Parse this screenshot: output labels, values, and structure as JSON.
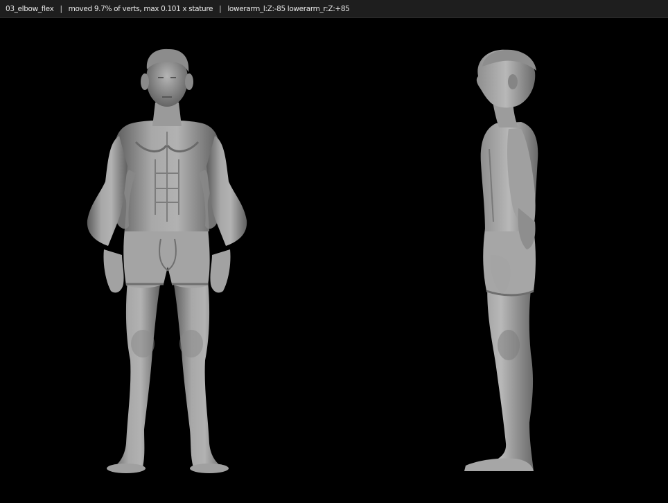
{
  "status_bar": {
    "scene_name": "03_elbow_flex",
    "separator": "|",
    "stats": "moved 9.7% of verts, max 0.101 x stature",
    "pose": "lowerarm_l:Z:-85 lowerarm_r:Z:+85"
  },
  "viewport": {
    "background_color": "#000000",
    "model_color": "#9a9a9a",
    "views": [
      {
        "name": "front-view",
        "icon": "human-figure-front"
      },
      {
        "name": "side-view",
        "icon": "human-figure-side"
      }
    ]
  }
}
